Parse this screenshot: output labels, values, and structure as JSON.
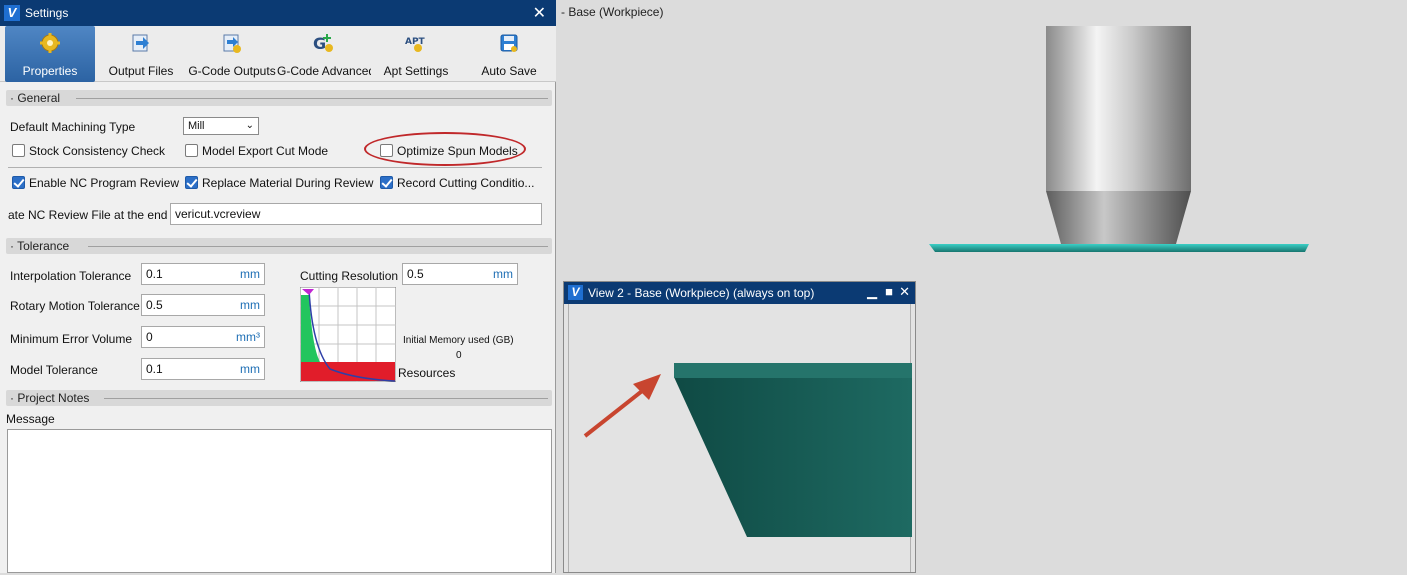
{
  "settings": {
    "title": "Settings",
    "toolbar": [
      {
        "label": "Properties",
        "icon": "gear-icon"
      },
      {
        "label": "Output Files",
        "icon": "output-arrow-icon"
      },
      {
        "label": "G-Code Outputs",
        "icon": "gcode-output-icon"
      },
      {
        "label": "G-Code Advanced",
        "icon": "gcode-advanced-icon"
      },
      {
        "label": "Apt Settings",
        "icon": "apt-icon"
      },
      {
        "label": "Auto Save",
        "icon": "save-icon"
      }
    ],
    "sections": {
      "general": "General",
      "tolerance": "Tolerance",
      "notes": "Project Notes"
    },
    "general": {
      "machining_type_label": "Default Machining Type",
      "machining_type_value": "Mill",
      "stock_check": "Stock Consistency Check",
      "model_export": "Model Export Cut Mode",
      "optimize_spun": "Optimize Spun Models",
      "enable_nc": "Enable NC Program Review",
      "replace_material": "Replace Material During Review",
      "record_cutting": "Record Cutting Conditio...",
      "review_file_label": "ate NC Review File at the end",
      "review_file_value": "vericut.vcreview"
    },
    "tolerance": {
      "interp_label": "Interpolation Tolerance",
      "interp_value": "0.1",
      "interp_unit": "mm",
      "rotary_label": "Rotary Motion Tolerance",
      "rotary_value": "0.5",
      "rotary_unit": "mm",
      "min_err_label": "Minimum Error Volume",
      "min_err_value": "0",
      "min_err_unit": "mm³",
      "model_tol_label": "Model Tolerance",
      "model_tol_value": "0.1",
      "model_tol_unit": "mm",
      "cut_res_label": "Cutting Resolution",
      "cut_res_value": "0.5",
      "cut_res_unit": "mm",
      "memory_label": "Initial Memory used (GB)",
      "memory_value": "0",
      "resources_label": "Resources"
    },
    "notes": {
      "message_label": "Message"
    }
  },
  "viewport": {
    "main_title": "- Base (Workpiece)",
    "view2_title": "View 2 - Base (Workpiece) (always on top)"
  },
  "colors": {
    "titlebar": "#0b3a73",
    "accent": "#2c63a3",
    "workpiece_teal": "#1c5c55",
    "annotation_red": "#c0282a"
  }
}
